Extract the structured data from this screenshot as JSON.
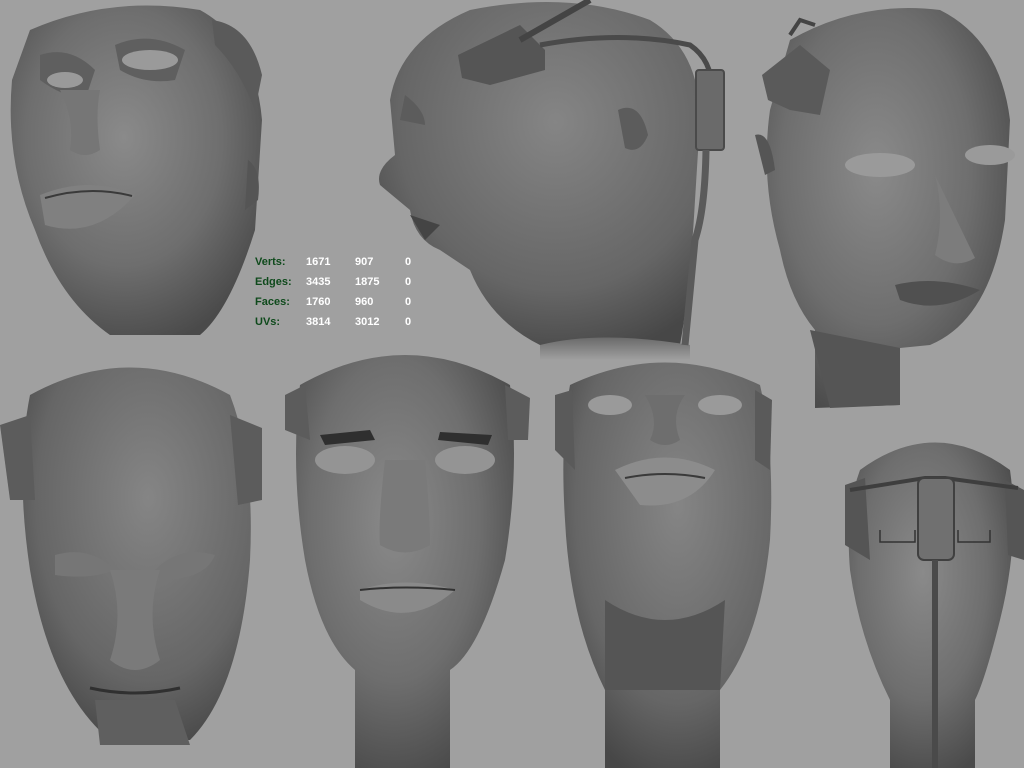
{
  "viewport": {
    "background": "#a0a0a0"
  },
  "hud": {
    "label_color": "#0f4a1c",
    "value_color": "#ffffff",
    "rows": [
      {
        "label": "Verts:",
        "values": [
          "1671",
          "907",
          "0"
        ]
      },
      {
        "label": "Edges:",
        "values": [
          "3435",
          "1875",
          "0"
        ]
      },
      {
        "label": "Faces:",
        "values": [
          "1760",
          "960",
          "0"
        ]
      },
      {
        "label": "UVs:",
        "values": [
          "3814",
          "3012",
          "0"
        ]
      }
    ]
  },
  "renders": [
    "head-three-quarter-up-view",
    "head-profile-headset-view",
    "head-three-quarter-right-view",
    "head-top-front-view",
    "head-front-view",
    "head-below-view",
    "head-back-headset-view"
  ]
}
